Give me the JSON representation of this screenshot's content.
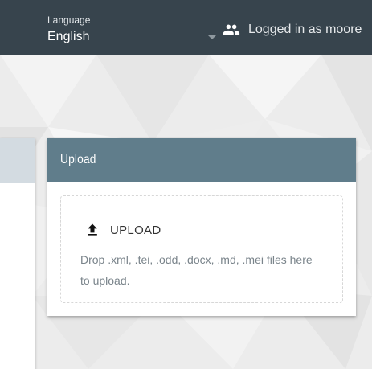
{
  "header": {
    "language": {
      "label": "Language",
      "value": "English"
    },
    "user": {
      "icon": "people-icon",
      "text": "Logged in as moore"
    }
  },
  "upload": {
    "title": "Upload",
    "button_label": "UPLOAD",
    "button_icon": "upload-icon",
    "hint": "Drop .xml, .tei, .odd, .docx, .md, .mei files here to upload."
  },
  "colors": {
    "header_bg": "#37444d",
    "card_header_bg": "#607d8b",
    "page_bg": "#ececec"
  }
}
